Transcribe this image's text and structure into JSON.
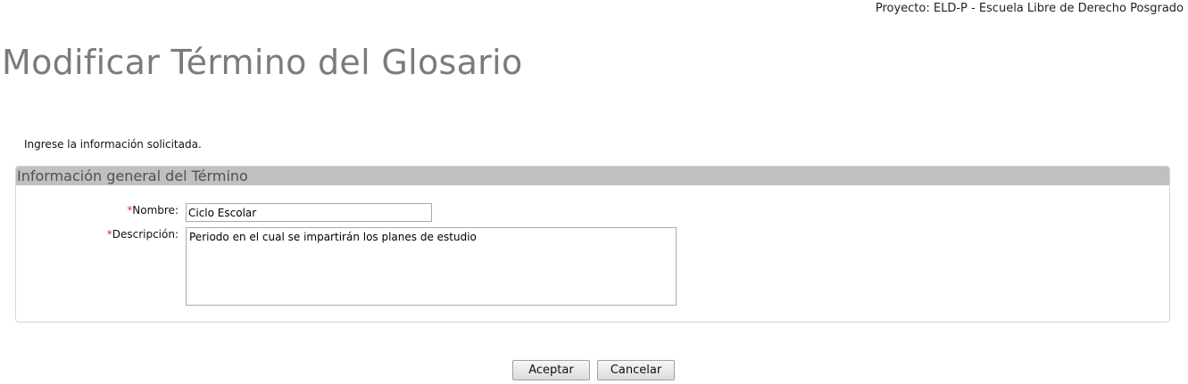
{
  "header": {
    "project_label": "Proyecto: ELD-P - Escuela Libre de Derecho Posgrado"
  },
  "page": {
    "title": "Modificar Término del Glosario",
    "instructions": "Ingrese la información solicitada."
  },
  "form": {
    "section_title": "Información general del Término",
    "required_marker": "*",
    "name": {
      "label": "Nombre:",
      "value": "Ciclo Escolar"
    },
    "description": {
      "label": "Descripción:",
      "value": "Periodo en el cual se impartirán los planes de estudio"
    }
  },
  "actions": {
    "accept_label": "Aceptar",
    "cancel_label": "Cancelar"
  },
  "colors": {
    "title_gray": "#7b7b7b",
    "section_header_bg": "#c0c0c0",
    "required_red": "#d63030"
  }
}
